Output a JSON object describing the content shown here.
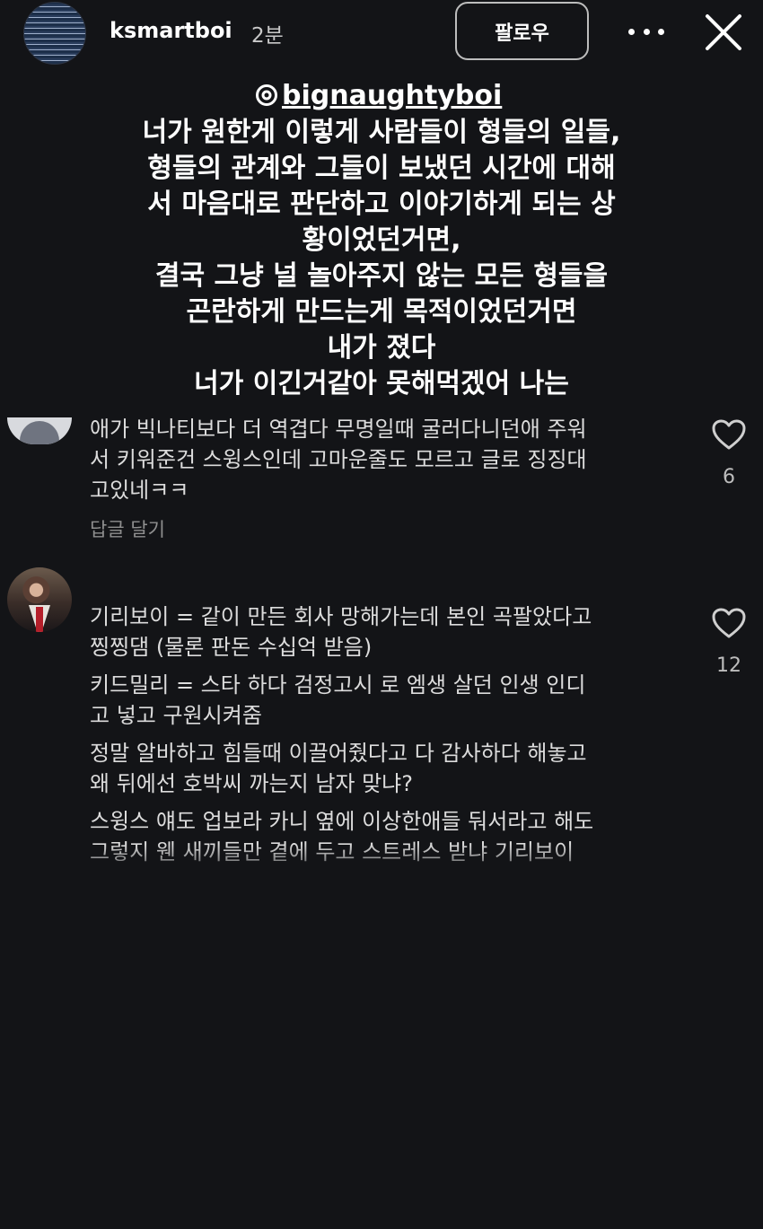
{
  "header": {
    "username": "ksmartboi",
    "time": "2분",
    "follow_label": "팔로우"
  },
  "story": {
    "mention": "bignaughtyboi",
    "lines": [
      "너가 원한게 이렇게 사람들이 형들의 일들,",
      "형들의 관계와 그들이 보냈던 시간에 대해",
      "서 마음대로 판단하고 이야기하게 되는 상",
      "황이었던거면,",
      "결국 그냥 널 놀아주지 않는 모든 형들을",
      "곤란하게 만드는게 목적이었던거면",
      "내가 졌다",
      "너가 이긴거같아 못해먹겠어 나는"
    ]
  },
  "comments": [
    {
      "lines": [
        "애가 빅나티보다 더 역겹다 무명일때 굴러다니던애 주워",
        "서 키워준건 스윙스인데 고마운줄도 모르고 글로 징징대",
        "고있네ㅋㅋ"
      ],
      "reply_label": "답글 달기",
      "likes": "6"
    },
    {
      "paragraphs": [
        [
          "기리보이 = 같이 만든 회사 망해가는데 본인 곡팔았다고",
          "찡찡댐 (물론 판돈 수십억 받음)"
        ],
        [
          "키드밀리 = 스타 하다 검정고시 로 엠생 살던 인생 인디",
          "고 넣고 구원시켜줌"
        ],
        [
          "정말 알바하고 힘들때 이끌어줬다고 다 감사하다 해놓고",
          "왜 뒤에선 호박씨 까는지 남자 맞냐?"
        ],
        [
          "스윙스 얘도 업보라 카니 옆에 이상한애들 둬서라고 해도",
          "그렇지 웬 새끼들만 곁에 두고 스트레스 받냐 기리보이"
        ]
      ],
      "likes": "12"
    }
  ]
}
